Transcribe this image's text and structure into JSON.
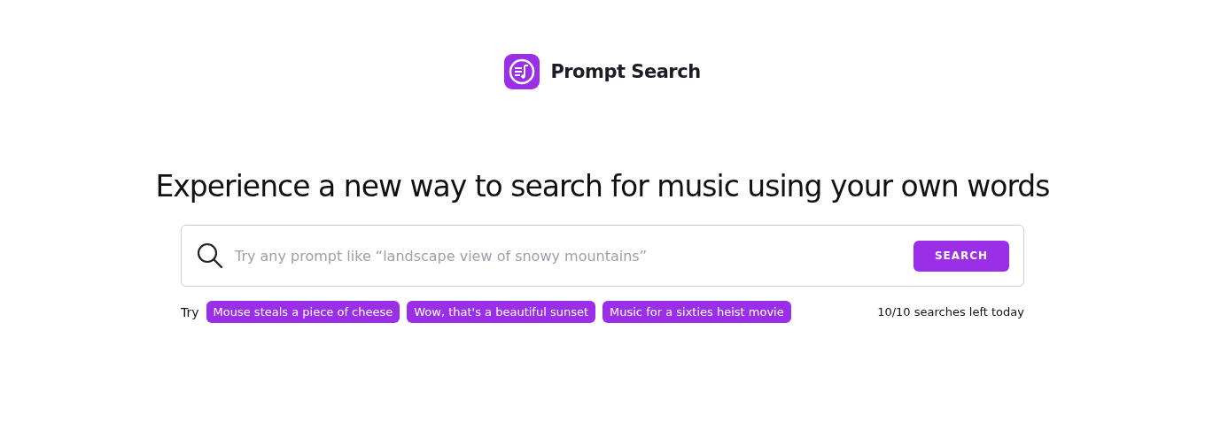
{
  "header": {
    "title": "Prompt Search"
  },
  "headline": "Experience a new way to search for music using your own words",
  "search": {
    "placeholder": "Try any prompt like “landscape view of snowy mountains”",
    "button": "SEARCH"
  },
  "suggestions": {
    "label": "Try",
    "items": [
      "Mouse steals a piece of cheese",
      "Wow, that's a beautiful sunset",
      "Music for a sixties heist movie"
    ]
  },
  "quota": "10/10 searches left today"
}
